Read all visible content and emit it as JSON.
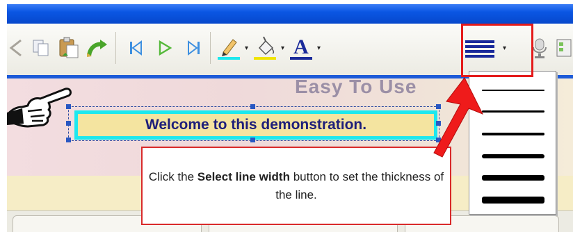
{
  "stage": {
    "banner_text": "Easy To Use"
  },
  "slide": {
    "title": "Welcome to this demonstration."
  },
  "callout": {
    "text_before": "Click the ",
    "bold_text": "Select line width",
    "text_after": " button to set the thickness of the line."
  },
  "toolbar": {
    "buttons": [
      "cut-icon",
      "copy-icon",
      "paste-icon",
      "undo-icon",
      "first-frame-icon",
      "play-icon",
      "last-frame-icon",
      "fill-color-icon",
      "line-color-icon",
      "font-color-icon",
      "select-line-width-icon"
    ]
  },
  "line_width_options": [
    "1",
    "2",
    "3",
    "4",
    "5",
    "6"
  ],
  "colors": {
    "highlight": "#e41b1b",
    "title_border": "#1de8ee",
    "title_fill": "#f4e4a0",
    "title_text": "#1d1e7a",
    "fill_swatch": "#1de8ee",
    "line_swatch": "#f0e400",
    "font_swatch": "#1a2a9a"
  }
}
